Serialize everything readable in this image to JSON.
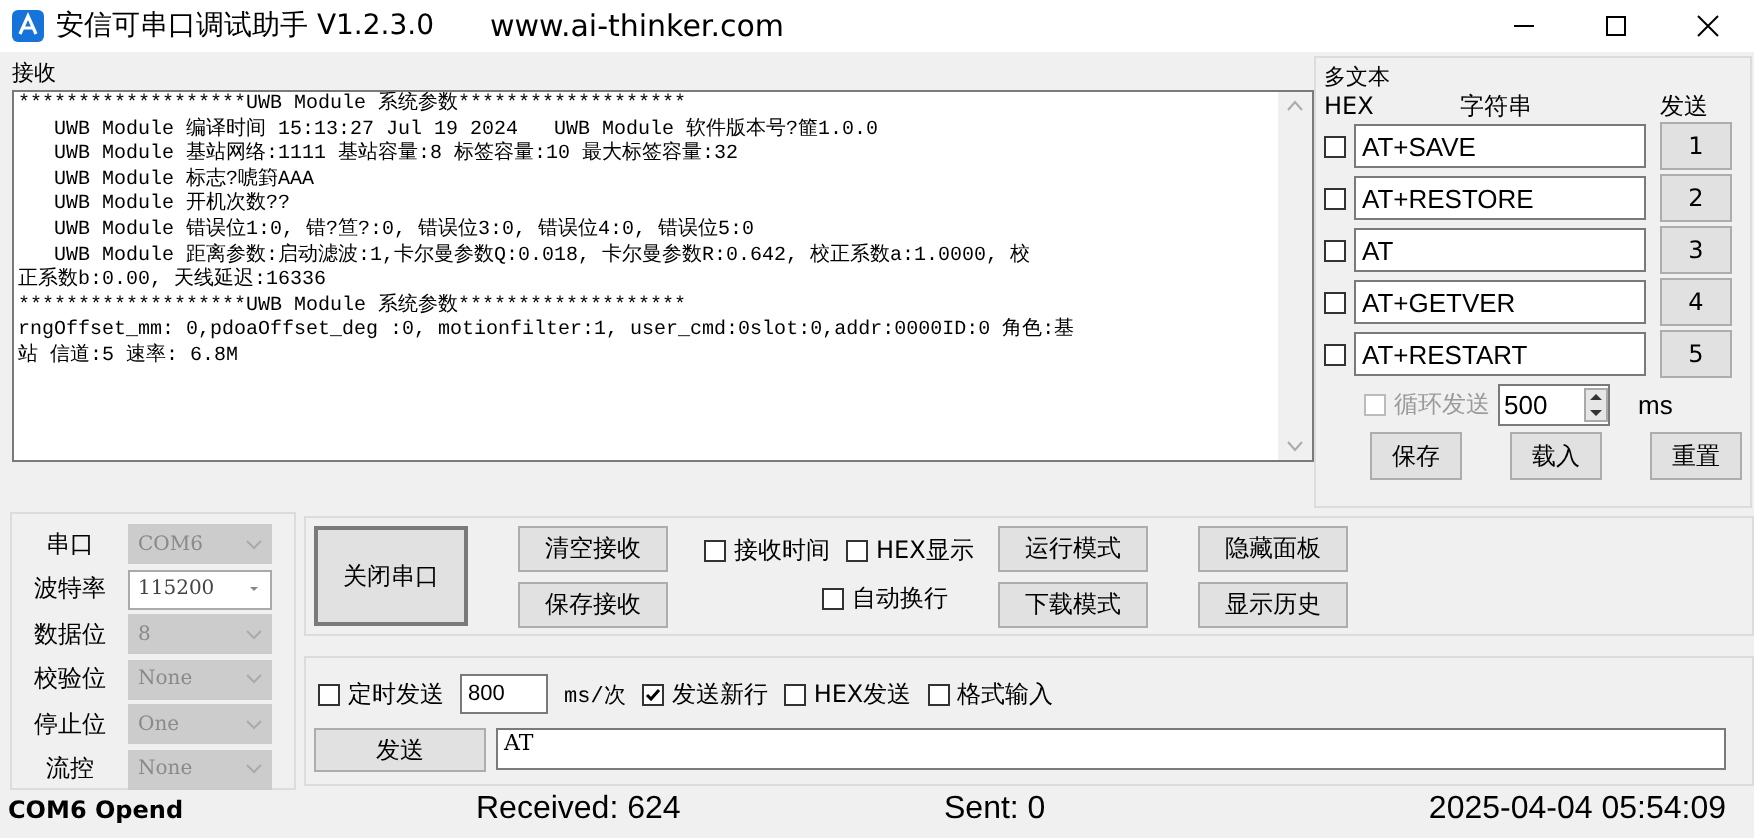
{
  "window": {
    "title": "安信可串口调试助手 V1.2.3.0",
    "url": "www.ai-thinker.com"
  },
  "receive": {
    "label": "接收",
    "lines": [
      "*******************UWB Module 系统参数*******************",
      "   UWB Module 编译时间 15:13:27 Jul 19 2024   UWB Module 软件版本号?篚1.0.0",
      "   UWB Module 基站网络:1111 基站容量:8 标签容量:10 最大标签容量:32",
      "   UWB Module 标志?唬篈AAA",
      "   UWB Module 开机次数??",
      "   UWB Module 错误位1:0, 错?笪?:0, 错误位3:0, 错误位4:0, 错误位5:0",
      "   UWB Module 距离参数:启动滤波:1,卡尔曼参数Q:0.018, 卡尔曼参数R:0.642, 校正系数a:1.0000, 校",
      "正系数b:0.00, 天线延迟:16336",
      "*******************UWB Module 系统参数*******************",
      "rngOffset_mm: 0,pdoaOffset_deg :0, motionfilter:1, user_cmd:0slot:0,addr:0000ID:0 角色:基",
      "站 信道:5 速率: 6.8M"
    ]
  },
  "multi_text": {
    "title": "多文本",
    "headers": [
      "HEX",
      "字符串",
      "发送"
    ],
    "rows": [
      {
        "checked": false,
        "value": "AT+SAVE",
        "button": "1"
      },
      {
        "checked": false,
        "value": "AT+RESTORE",
        "button": "2"
      },
      {
        "checked": false,
        "value": "AT",
        "button": "3"
      },
      {
        "checked": false,
        "value": "AT+GETVER",
        "button": "4"
      },
      {
        "checked": false,
        "value": "AT+RESTART",
        "button": "5"
      }
    ],
    "loop": {
      "label": "循环发送",
      "checked": false,
      "disabled": true,
      "interval": "500",
      "unit": "ms"
    },
    "buttons": [
      "保存",
      "载入",
      "重置"
    ]
  },
  "port_settings": [
    {
      "label": "串口",
      "value": "COM6",
      "disabled": true
    },
    {
      "label": "波特率",
      "value": "115200",
      "disabled": false
    },
    {
      "label": "数据位",
      "value": "8",
      "disabled": true
    },
    {
      "label": "校验位",
      "value": "None",
      "disabled": true
    },
    {
      "label": "停止位",
      "value": "One",
      "disabled": true
    },
    {
      "label": "流控",
      "value": "None",
      "disabled": true
    }
  ],
  "controls": {
    "open_button": "关闭串口",
    "receive_buttons": [
      "清空接收",
      "保存接收"
    ],
    "options": [
      {
        "label": "接收时间",
        "checked": false
      },
      {
        "label": "HEX显示",
        "checked": false
      },
      {
        "label": "自动换行",
        "checked": false
      }
    ],
    "mode_buttons": [
      "运行模式",
      "下载模式"
    ],
    "panel_buttons": [
      "隐藏面板",
      "显示历史"
    ]
  },
  "send": {
    "timed": {
      "label": "定时发送",
      "checked": false
    },
    "interval": "800",
    "unit": "ms/次",
    "options": [
      {
        "label": "发送新行",
        "checked": true
      },
      {
        "label": "HEX发送",
        "checked": false
      },
      {
        "label": "格式输入",
        "checked": false
      }
    ],
    "button": "发送",
    "value": "AT"
  },
  "status_bar": {
    "port": "COM6 Opend",
    "received": "Received: 624",
    "sent": "Sent: 0",
    "time": "2025-04-04 05:54:09"
  }
}
